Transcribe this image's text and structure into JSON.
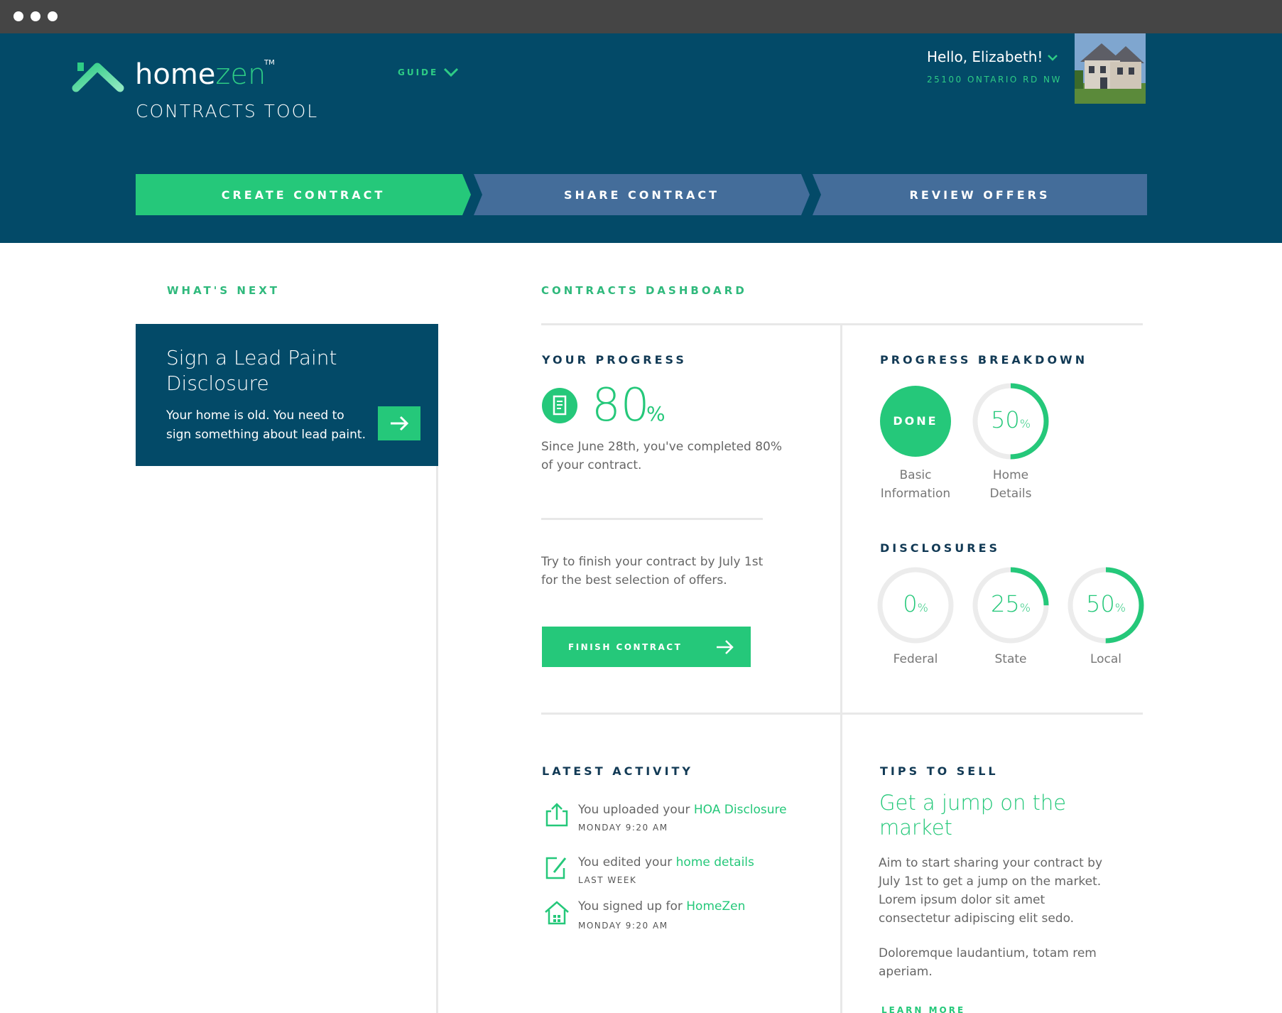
{
  "brand": {
    "name_part1": "home",
    "name_part2": "zen",
    "tm": "TM",
    "tool_title": "CONTRACTS TOOL",
    "accent_color": "#25c87a",
    "header_color": "#034a68"
  },
  "header": {
    "guide_label": "GUIDE",
    "greeting": "Hello, Elizabeth!",
    "address": "25100 ONTARIO RD NW",
    "avatar": "house-photo"
  },
  "steps": [
    {
      "label": "CREATE CONTRACT",
      "state": "active"
    },
    {
      "label": "SHARE CONTRACT",
      "state": "inactive"
    },
    {
      "label": "REVIEW OFFERS",
      "state": "inactive"
    }
  ],
  "whats_next": {
    "section_label": "WHAT'S NEXT",
    "card_title": "Sign a Lead Paint Disclosure",
    "card_desc": "Your home is old. You need to sign something about lead paint.",
    "button_icon": "arrow-right-icon"
  },
  "dashboard": {
    "section_label": "CONTRACTS DASHBOARD",
    "progress": {
      "label": "YOUR PROGRESS",
      "value": "80",
      "unit": "%",
      "summary": "Since June 28th, you've completed 80% of your contract.",
      "tip": "Try to finish your contract by July 1st for the best selection of offers.",
      "button_label": "FINISH CONTRACT"
    },
    "breakdown": {
      "label": "PROGRESS BREAKDOWN",
      "done_label": "DONE",
      "basic_caption": "Basic Information",
      "home_caption": "Home Details",
      "home_value": "50",
      "home_fraction": 0.5
    },
    "disclosures": {
      "label": "DISCLOSURES",
      "items": [
        {
          "value": "0",
          "caption": "Federal",
          "fraction": 0
        },
        {
          "value": "25",
          "caption": "State",
          "fraction": 0.25
        },
        {
          "value": "50",
          "caption": "Local",
          "fraction": 0.5
        }
      ],
      "unit": "%"
    },
    "activity": {
      "label": "LATEST ACTIVITY",
      "items": [
        {
          "text": "You uploaded your ",
          "highlight": "HOA Disclosure",
          "time": "MONDAY 9:20 AM",
          "icon": "upload-icon"
        },
        {
          "text": "You edited your ",
          "highlight": "home details",
          "time": "LAST WEEK",
          "icon": "edit-icon"
        },
        {
          "text": "You signed up for ",
          "highlight": "HomeZen",
          "time": "MONDAY 9:20 AM",
          "icon": "home-icon"
        }
      ]
    },
    "tips": {
      "label": "TIPS TO SELL",
      "title": "Get a jump on the market",
      "para1": "Aim to start sharing your contract by July 1st to get a jump on the market. Lorem ipsum dolor sit amet consectetur adipiscing elit sedo.",
      "para2": "Doloremque laudantium, totam rem aperiam.",
      "link": "LEARN MORE"
    }
  }
}
